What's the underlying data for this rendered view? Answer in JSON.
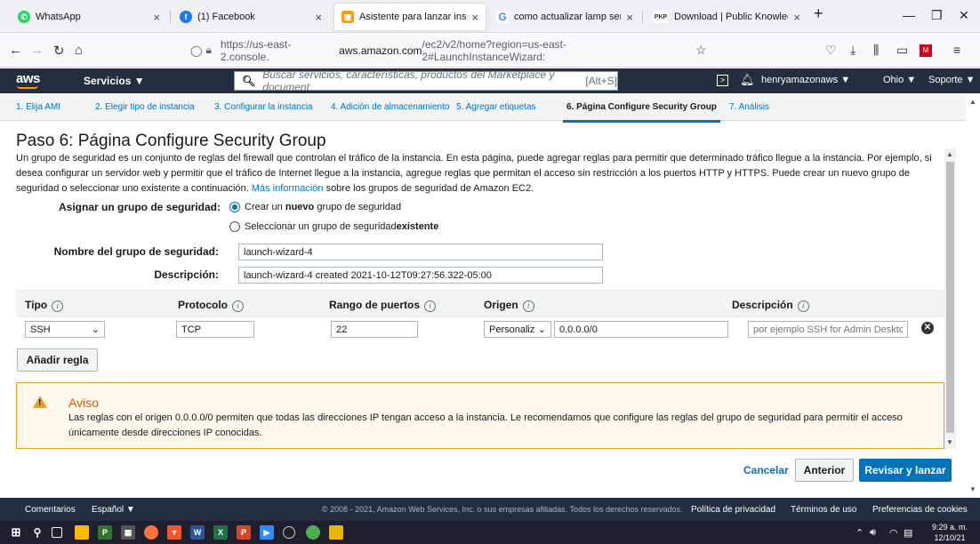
{
  "browser": {
    "tabs": [
      {
        "title": "WhatsApp",
        "icon": "whatsapp-icon",
        "color": "#25d366"
      },
      {
        "title": "(1) Facebook",
        "icon": "facebook-icon",
        "color": "#1877f2"
      },
      {
        "title": "Asistente para lanzar instancia |",
        "icon": "aws-icon",
        "color": "#ff9900"
      },
      {
        "title": "como actualizar lamp server - B",
        "icon": "google-icon",
        "color": "#4285f4"
      },
      {
        "title": "Download | Public Knowledge P",
        "icon": "pkp-icon",
        "color": "#333333"
      }
    ],
    "url_prefix": "https://us-east-2.console.",
    "url_domain": "aws.amazon.com",
    "url_suffix": "/ec2/v2/home?region=us-east-2#LaunchInstanceWizard:"
  },
  "aws_header": {
    "logo": "aws",
    "services_label": "Servicios ▼",
    "search_placeholder": "Buscar servicios, características, productos del Marketplace y document",
    "search_shortcut": "[Alt+S]",
    "user_label": "henryamazonaws ▼",
    "region_label": "Ohio ▼",
    "support_label": "Soporte ▼"
  },
  "steps": [
    "1. Elija AMI",
    "2. Elegir tipo de instancia",
    "3. Configurar la instancia",
    "4. Adición de almacenamiento",
    "5. Agregar etiquetas",
    "6. Página Configure Security Group",
    "7. Análisis"
  ],
  "page": {
    "title": "Paso 6: Página Configure Security Group",
    "intro_text": "Un grupo de seguridad es un conjunto de reglas del firewall que controlan el tráfico de la instancia. En esta página, puede agregar reglas para permitir que determinado tráfico llegue a la instancia. Por ejemplo, si desea configurar un servidor web y permitir que el tráfico de Internet llegue a la instancia, agregue reglas que permitan el acceso sin restricción a los puertos HTTP y HTTPS. Puede crear un nuevo grupo de seguridad o seleccionar uno existente a continuación.",
    "intro_link": "Más información",
    "intro_tail": "sobre los grupos de seguridad de Amazon EC2.",
    "assign_label": "Asignar un grupo de seguridad:",
    "radio_new_pre": "Crear un ",
    "radio_new_bold": "nuevo",
    "radio_new_post": " grupo de seguridad",
    "radio_existing_pre": "Seleccionar un grupo de seguridad ",
    "radio_existing_bold": "existente",
    "name_label": "Nombre del grupo de seguridad:",
    "name_value": "launch-wizard-4",
    "desc_label": "Descripción:",
    "desc_value": "launch-wizard-4 created 2021-10-12T09:27:56.322-05:00"
  },
  "table": {
    "headers": [
      "Tipo",
      "Protocolo",
      "Rango de puertos",
      "Origen",
      "Descripción"
    ],
    "row": {
      "type": "SSH",
      "protocol": "TCP",
      "port_range": "22",
      "source_mode": "Personaliz",
      "source_cidr": "0.0.0.0/0",
      "description_placeholder": "por ejemplo SSH for Admin Deskto"
    },
    "add_rule": "Añadir regla"
  },
  "warning": {
    "title": "Aviso",
    "body": "Las reglas con el origen 0.0.0.0/0 permiten que todas las direcciones IP tengan acceso a la instancia. Le recomendamos que configure las reglas del grupo de seguridad para permitir el acceso únicamente desde direcciones IP conocidas."
  },
  "actions": {
    "cancel": "Cancelar",
    "previous": "Anterior",
    "review_launch": "Revisar y lanzar"
  },
  "footer": {
    "feedback": "Comentarios",
    "language": "Español ▼",
    "copyright": "© 2008 - 2021, Amazon Web Services, Inc. o sus empresas afiliadas. Todos los derechos reservados.",
    "privacy": "Política de privacidad",
    "terms": "Términos de uso",
    "cookies": "Preferencias de cookies"
  },
  "taskbar": {
    "time": "9:29 a. m.",
    "date": "12/10/21"
  },
  "colors": {
    "aws_dark": "#232f3e",
    "aws_orange": "#ff9900",
    "link_blue": "#0073bb",
    "warning_border": "#eb9c2a"
  }
}
